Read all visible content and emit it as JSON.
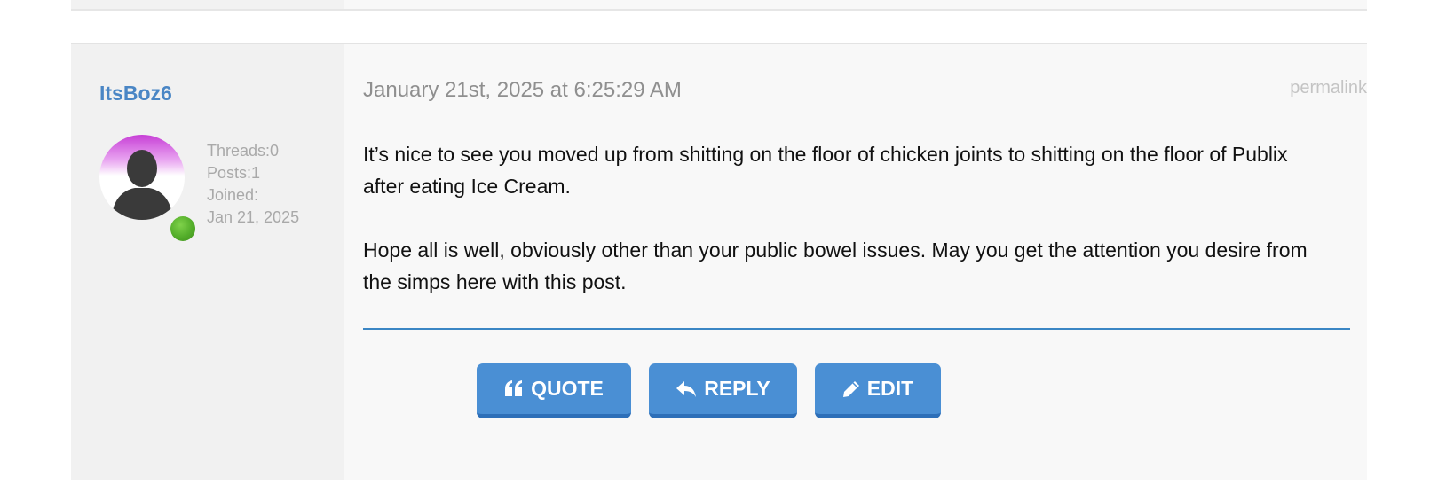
{
  "post": {
    "author": {
      "username": "ItsBoz6",
      "threads": "Threads:0",
      "posts": "Posts:1",
      "joined_label": "Joined:",
      "joined_date": "Jan 21, 2025",
      "online": true
    },
    "date": "January 21st, 2025 at 6:25:29 AM",
    "permalink_label": "permalink",
    "body": {
      "paragraph_1": "It’s nice to see you moved up from shitting on the floor of chicken joints to shitting on the floor of Publix after eating Ice Cream.",
      "paragraph_2": "Hope all is well, obviously other than your public bowel issues. May you get the attention you desire from the simps here with this post."
    },
    "actions": {
      "quote_label": "QUOTE",
      "reply_label": "REPLY",
      "edit_label": "EDIT"
    }
  },
  "colors": {
    "username": "#4a86c5",
    "button": "#4a8fd4",
    "divider": "#3b86c4",
    "online": "#53ad2a"
  },
  "icons": {
    "quote": "quote-icon",
    "reply": "reply-icon",
    "edit": "pencil-icon",
    "avatar": "default-user-avatar"
  }
}
